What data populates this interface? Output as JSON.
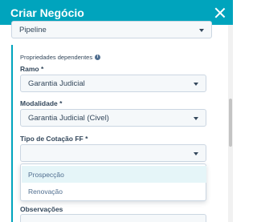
{
  "dialog": {
    "title": "Criar Negócio"
  },
  "pipeline": {
    "value": "Pipeline"
  },
  "dependent": {
    "title": "Propriedades dependentes",
    "info_glyph": "i"
  },
  "ramo": {
    "label": "Ramo *",
    "value": "Garantia Judicial"
  },
  "modalidade": {
    "label": "Modalidade *",
    "value": "Garantia Judicial (Civel)"
  },
  "tipo_cotacao": {
    "label": "Tipo de Cotação FF *",
    "value": "",
    "options": [
      "Prospecção",
      "Renovação"
    ]
  },
  "observacoes": {
    "label": "Observações"
  },
  "colors": {
    "header": "#00a4bd",
    "panel_border": "#00a4bd",
    "text": "#33475b",
    "option_highlight": "#e5f5f8"
  },
  "icons": {
    "close": "close-icon",
    "info": "info-icon",
    "dropdown_caret": "chevron-down-icon"
  }
}
